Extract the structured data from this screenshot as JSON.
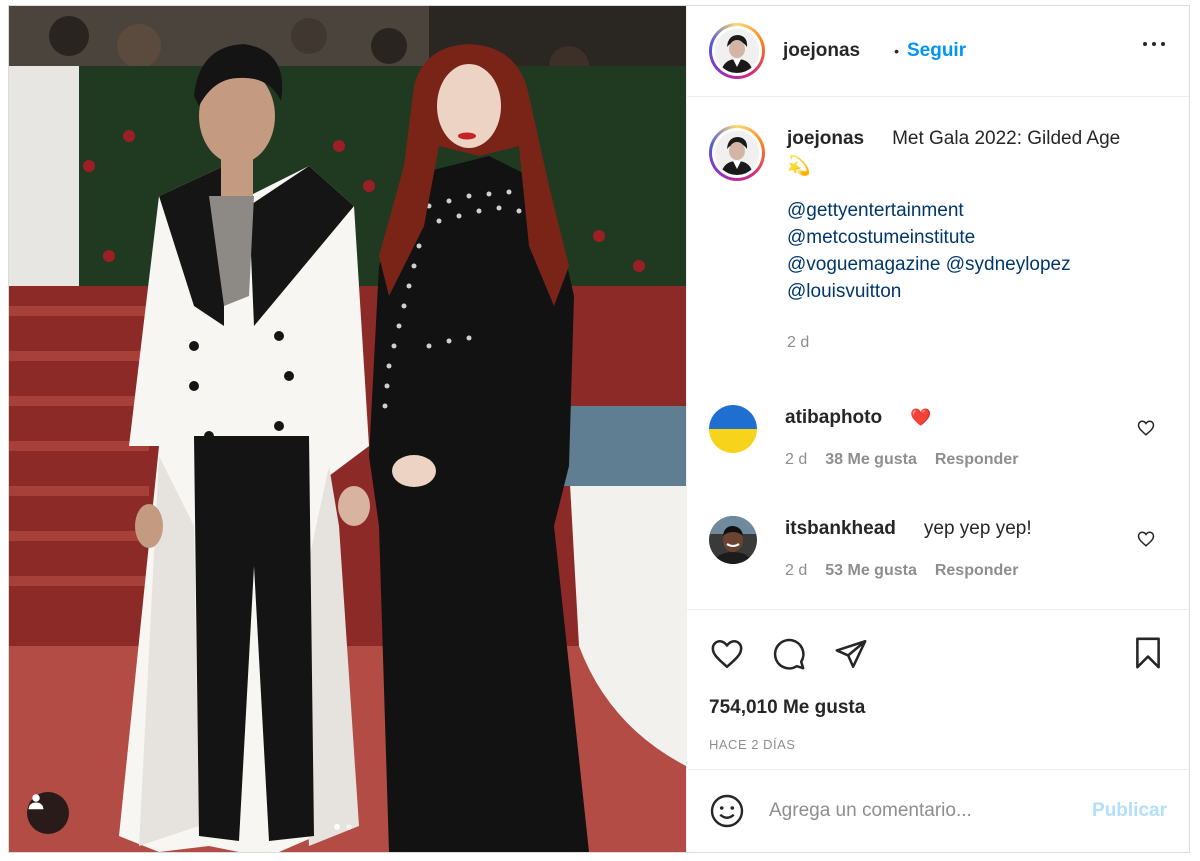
{
  "header": {
    "username": "joejonas",
    "separator": "•",
    "follow_label": "Seguir",
    "more_icon": "more-horizontal-icon"
  },
  "caption": {
    "username": "joejonas",
    "text": "Met Gala 2022: Gilded Age",
    "emoji": "💫",
    "mentions": [
      "@gettyentertainment",
      "@metcostumeinstitute",
      "@voguemagazine @sydneylopez",
      "@louisvuitton"
    ],
    "age": "2 d"
  },
  "comments": [
    {
      "username": "atibaphoto",
      "text": "❤️",
      "age": "2 d",
      "likes": "38 Me gusta",
      "reply_label": "Responder"
    },
    {
      "username": "itsbankhead",
      "text": "yep yep yep!",
      "age": "2 d",
      "likes": "53 Me gusta",
      "reply_label": "Responder"
    }
  ],
  "actions": {
    "icons": [
      "heart-icon",
      "comment-icon",
      "share-icon",
      "bookmark-icon"
    ],
    "likes": "754,010 Me gusta",
    "time": "HACE 2 DÍAS"
  },
  "add_comment": {
    "placeholder": "Agrega un comentario...",
    "publish_label": "Publicar"
  },
  "colors": {
    "link_blue": "#0095f6",
    "mention_blue": "#00376b",
    "muted": "#8e8e8e",
    "publish_disabled": "#b2dffc",
    "heart_red": "#c0203a"
  },
  "photo": {
    "tag_icon": "user-tag-icon",
    "carousel_count": 2,
    "carousel_active": 1
  }
}
